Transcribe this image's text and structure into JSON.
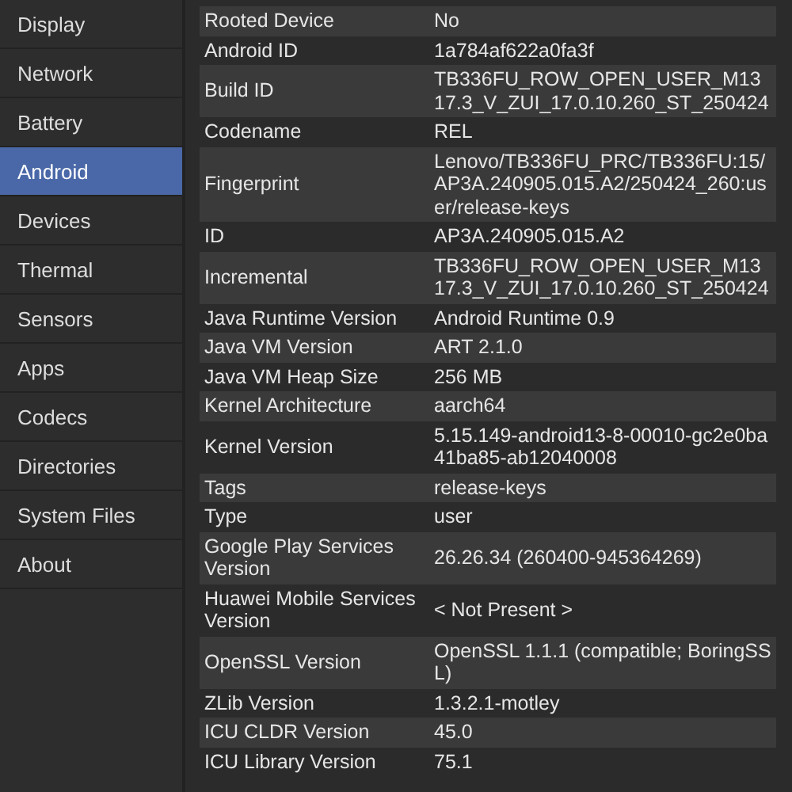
{
  "sidebar": {
    "items": [
      {
        "label": "Display",
        "selected": false
      },
      {
        "label": "Network",
        "selected": false
      },
      {
        "label": "Battery",
        "selected": false
      },
      {
        "label": "Android",
        "selected": true
      },
      {
        "label": "Devices",
        "selected": false
      },
      {
        "label": "Thermal",
        "selected": false
      },
      {
        "label": "Sensors",
        "selected": false
      },
      {
        "label": "Apps",
        "selected": false
      },
      {
        "label": "Codecs",
        "selected": false
      },
      {
        "label": "Directories",
        "selected": false
      },
      {
        "label": "System Files",
        "selected": false
      },
      {
        "label": "About",
        "selected": false
      }
    ]
  },
  "table": {
    "rows": [
      {
        "label": "Rooted Device",
        "value": "No"
      },
      {
        "label": "Android ID",
        "value": "1a784af622a0fa3f"
      },
      {
        "label": "Build ID",
        "value": "TB336FU_ROW_OPEN_USER_M1317.3_V_ZUI_17.0.10.260_ST_250424"
      },
      {
        "label": "Codename",
        "value": "REL"
      },
      {
        "label": "Fingerprint",
        "value": "Lenovo/TB336FU_PRC/TB336FU:15/AP3A.240905.015.A2/250424_260:user/release-keys"
      },
      {
        "label": "ID",
        "value": "AP3A.240905.015.A2"
      },
      {
        "label": "Incremental",
        "value": "TB336FU_ROW_OPEN_USER_M1317.3_V_ZUI_17.0.10.260_ST_250424"
      },
      {
        "label": "Java Runtime Version",
        "value": "Android Runtime 0.9"
      },
      {
        "label": "Java VM Version",
        "value": "ART 2.1.0"
      },
      {
        "label": "Java VM Heap Size",
        "value": "256 MB"
      },
      {
        "label": "Kernel Architecture",
        "value": "aarch64"
      },
      {
        "label": "Kernel Version",
        "value": "5.15.149-android13-8-00010-gc2e0ba41ba85-ab12040008"
      },
      {
        "label": "Tags",
        "value": "release-keys"
      },
      {
        "label": "Type",
        "value": "user"
      },
      {
        "label": "Google Play Services Version",
        "value": "26.26.34 (260400-945364269)"
      },
      {
        "label": "Huawei Mobile Services Version",
        "value": "< Not Present >"
      },
      {
        "label": "OpenSSL Version",
        "value": "OpenSSL 1.1.1 (compatible; BoringSSL)"
      },
      {
        "label": "ZLib Version",
        "value": "1.3.2.1-motley"
      },
      {
        "label": "ICU CLDR Version",
        "value": "45.0"
      },
      {
        "label": "ICU Library Version",
        "value": "75.1"
      }
    ]
  }
}
